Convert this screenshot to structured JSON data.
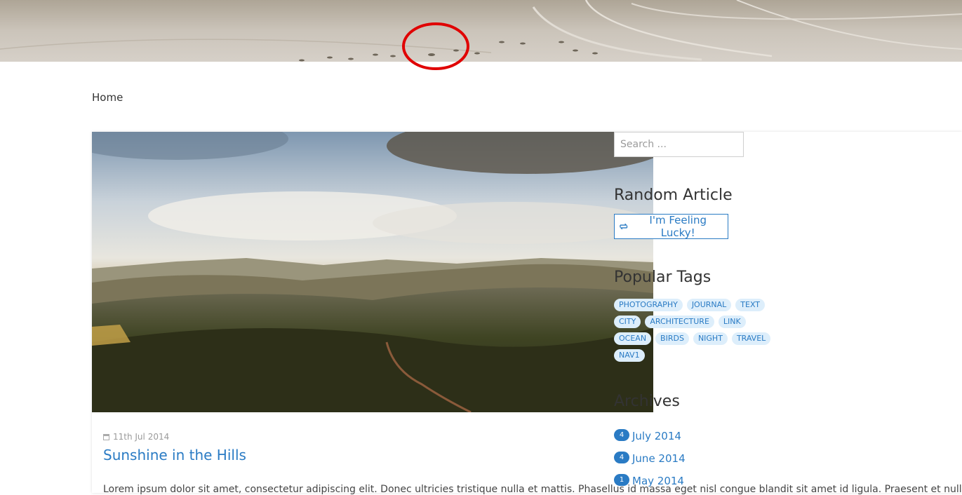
{
  "breadcrumb": {
    "home_label": "Home"
  },
  "post": {
    "date": "11th Jul 2014",
    "title": "Sunshine in the Hills",
    "excerpt": "Lorem ipsum dolor sit amet, consectetur adipiscing elit. Donec ultricies tristique nulla et mattis. Phasellus id massa eget nisl congue blandit sit amet id ligula. Praesent et nulla"
  },
  "sidebar": {
    "search_placeholder": "Search ...",
    "random_heading": "Random Article",
    "lucky_label": "I'm Feeling Lucky!",
    "tags_heading": "Popular Tags",
    "tag_rows": [
      [
        "PHOTOGRAPHY",
        "JOURNAL",
        "TEXT"
      ],
      [
        "CITY",
        "ARCHITECTURE",
        "LINK"
      ],
      [
        "OCEAN",
        "BIRDS",
        "NIGHT",
        "TRAVEL"
      ],
      [
        "NAV1"
      ]
    ],
    "archives_heading": "Archives",
    "archives": [
      {
        "count": "4",
        "label": "July 2014"
      },
      {
        "count": "4",
        "label": "June 2014"
      },
      {
        "count": "1",
        "label": "May 2014"
      }
    ]
  },
  "colors": {
    "link": "#2a7bc4",
    "tag_bg": "#ddeefb",
    "annotation": "#e00000"
  }
}
